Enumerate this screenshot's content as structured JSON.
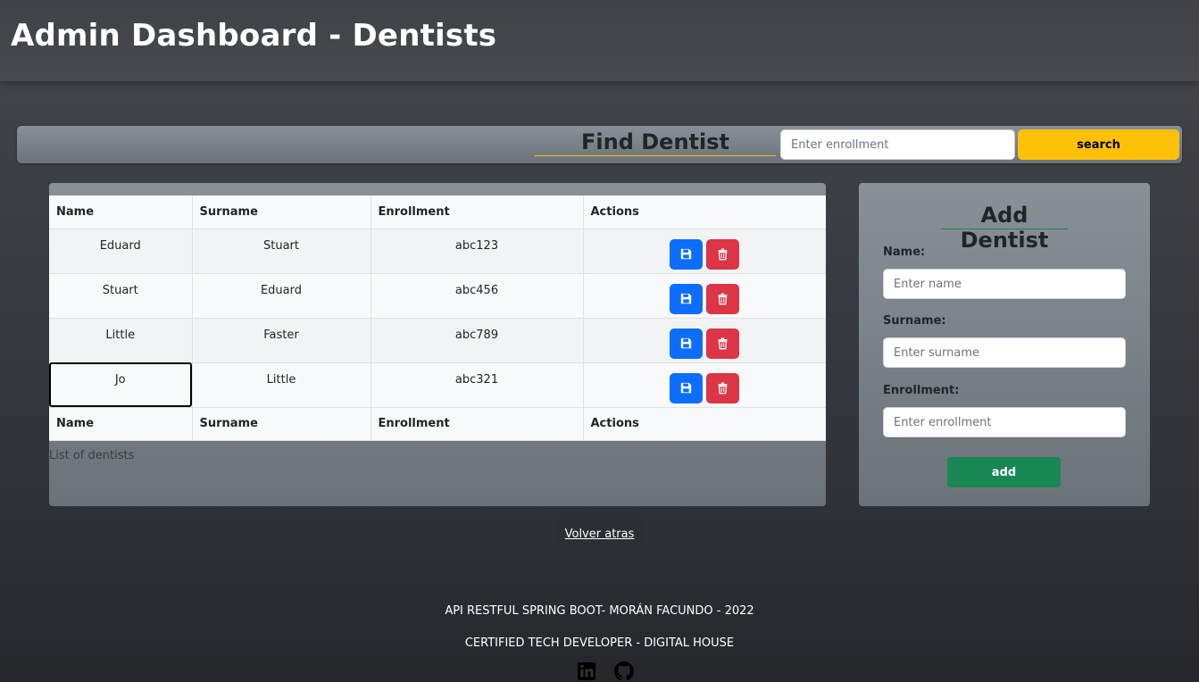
{
  "header": {
    "title": "Admin Dashboard - Dentists"
  },
  "find": {
    "title": "Find Dentist",
    "placeholder": "Enter enrollment",
    "button_label": "search"
  },
  "table": {
    "columns": [
      "Name",
      "Surname",
      "Enrollment",
      "Actions"
    ],
    "rows": [
      {
        "name": "Eduard",
        "surname": "Stuart",
        "enrollment": "abc123"
      },
      {
        "name": "Stuart",
        "surname": "Eduard",
        "enrollment": "abc456"
      },
      {
        "name": "Little",
        "surname": "Faster",
        "enrollment": "abc789"
      },
      {
        "name": "Jo",
        "surname": "Little",
        "enrollment": "abc321"
      }
    ],
    "caption": "List of dentists"
  },
  "add_form": {
    "title": "Add Dentist",
    "name_label": "Name:",
    "name_placeholder": "Enter name",
    "surname_label": "Surname:",
    "surname_placeholder": "Enter surname",
    "enrollment_label": "Enrollment:",
    "enrollment_placeholder": "Enter enrollment",
    "button_label": "add"
  },
  "back_button": "Volver atras",
  "footer": {
    "line1": "API RESTFUL SPRING BOOT- MORÁN FACUNDO - 2022",
    "line2": "CERTIFIED TECH DEVELOPER - DIGITAL HOUSE",
    "icons": [
      "linkedin-icon",
      "github-icon"
    ]
  },
  "colors": {
    "search": "#ffc107",
    "save": "#0d6efd",
    "delete": "#dc3545",
    "add": "#198754"
  }
}
